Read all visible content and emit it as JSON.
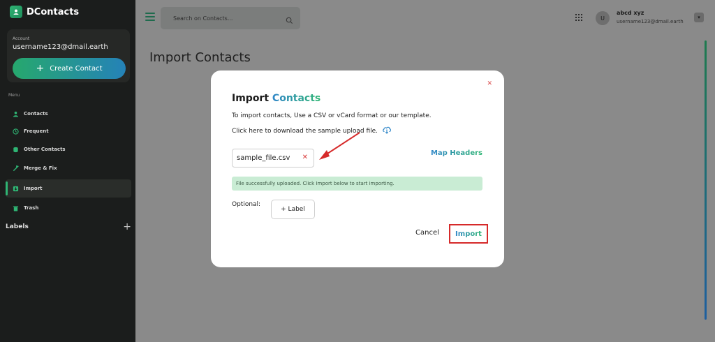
{
  "brand": {
    "name": "DContacts"
  },
  "account": {
    "label": "Account",
    "email": "username123@dmail.earth",
    "create_label": "Create Contact"
  },
  "menu": {
    "label": "Menu",
    "items": [
      {
        "label": "Contacts",
        "icon": "person-icon",
        "active": false
      },
      {
        "label": "Frequent",
        "icon": "history-icon",
        "active": false
      },
      {
        "label": "Other Contacts",
        "icon": "database-icon",
        "active": false
      },
      {
        "label": "Merge & Fix",
        "icon": "wrench-icon",
        "active": false
      },
      {
        "label": "Import",
        "icon": "import-icon",
        "active": true
      },
      {
        "label": "Trash",
        "icon": "trash-icon",
        "active": false
      }
    ]
  },
  "labels": {
    "title": "Labels"
  },
  "search": {
    "placeholder": "Search on Contacts..."
  },
  "user": {
    "avatar_initial": "U",
    "name": "abcd xyz",
    "email": "username123@dmail.earth"
  },
  "page": {
    "title": "Import Contacts"
  },
  "modal": {
    "title_plain": "Import",
    "title_accent": "Contacts",
    "description": "To import contacts, Use a CSV or vCard format or our template.",
    "download_text": "Click here to download the sample upload file.",
    "file_name": "sample_file.csv",
    "map_headers": "Map Headers",
    "success_message": "File successfully uploaded. Click Import below to start importing.",
    "optional_label": "Optional:",
    "label_button": "+ Label",
    "cancel": "Cancel",
    "import": "Import"
  },
  "colors": {
    "accent_green": "#2fb574",
    "accent_blue": "#2f86c8",
    "highlight_red": "#d62a2a"
  }
}
